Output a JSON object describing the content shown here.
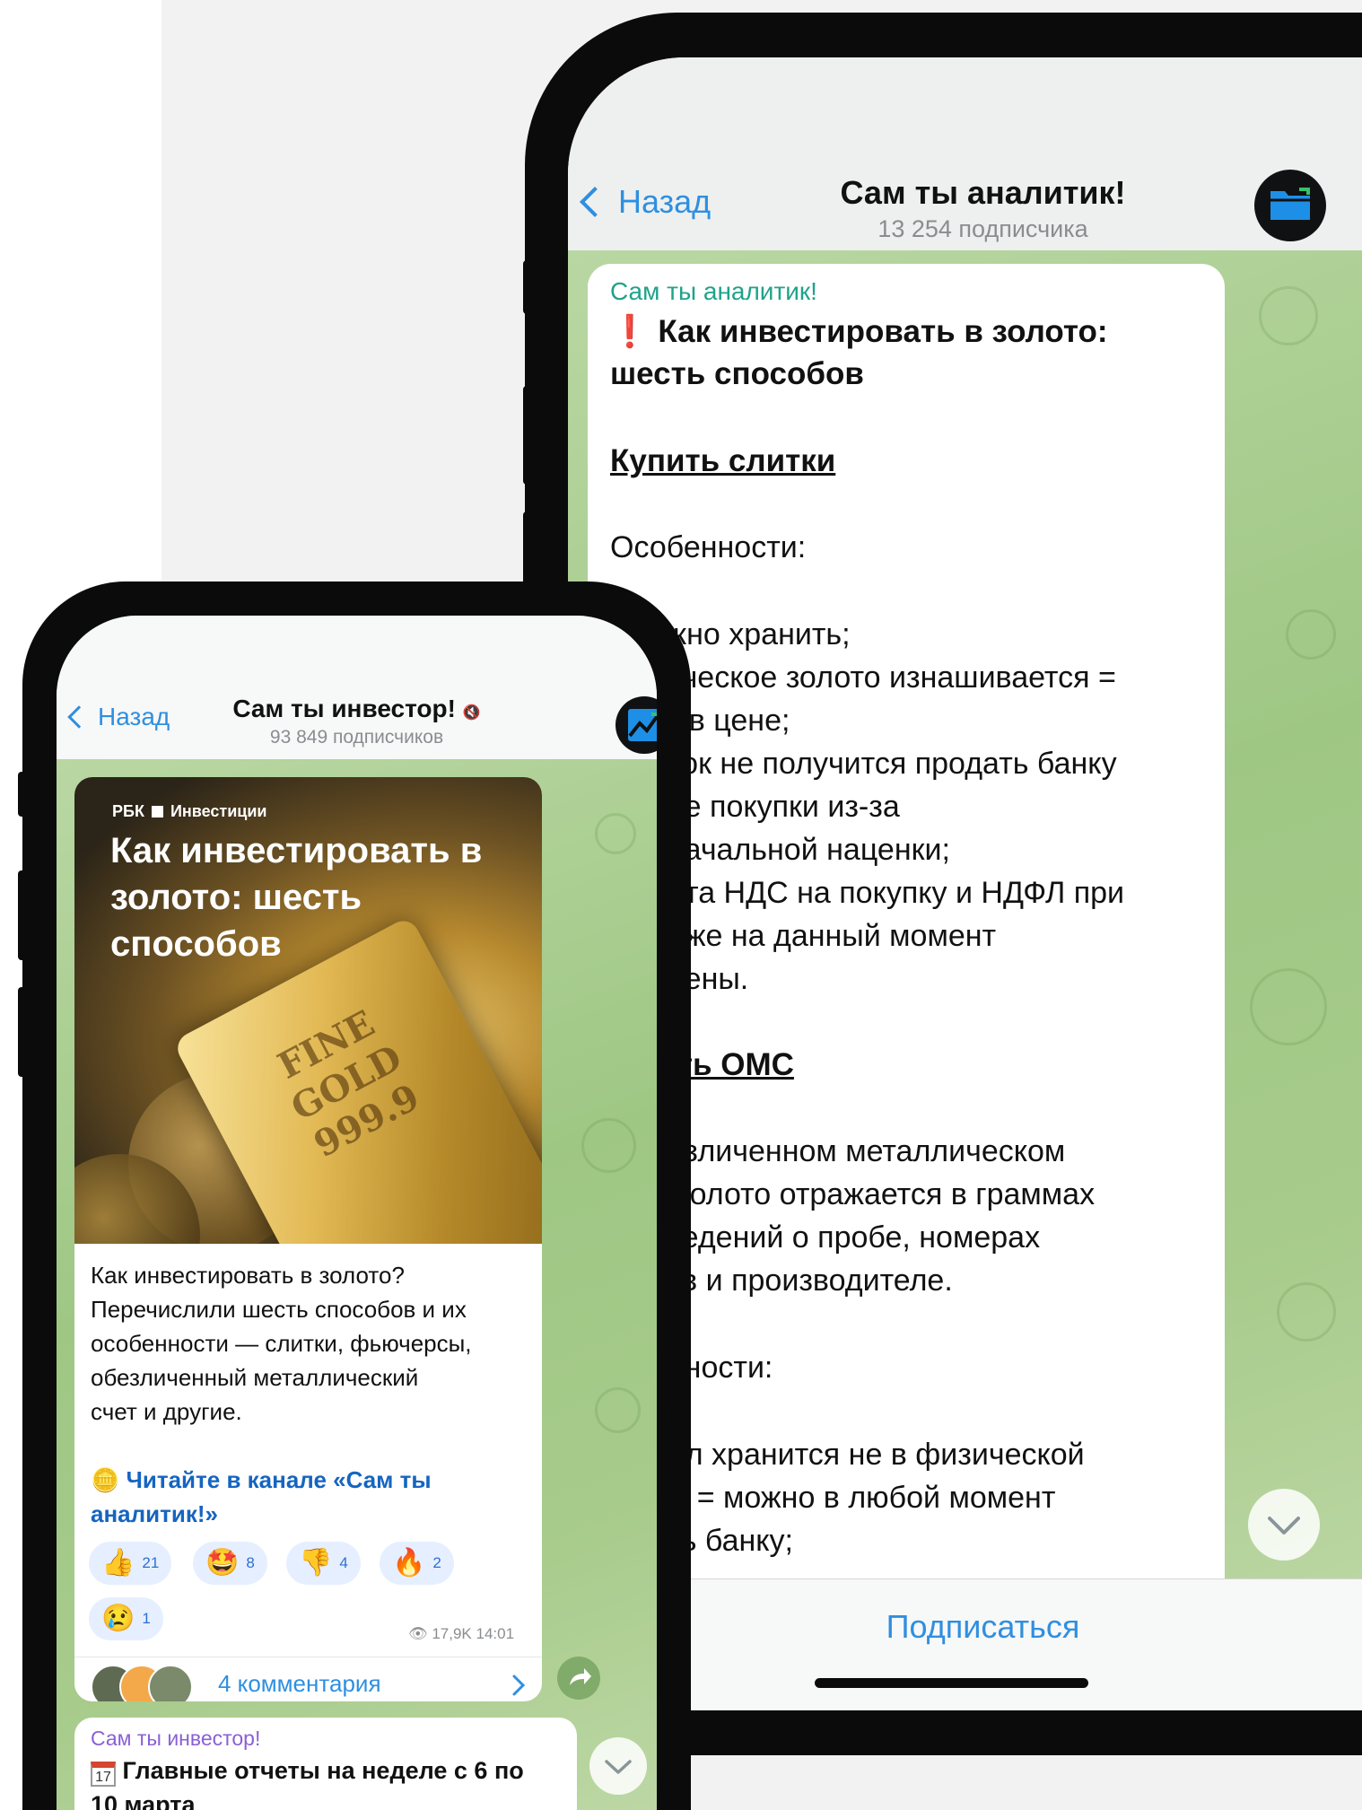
{
  "back_phone": {
    "back_label": "Назад",
    "channel_title": "Сам ты аналитик!",
    "subscribers": "13 254 подписчика",
    "avatar_icon": "folder-icon",
    "message": {
      "sender": "Сам ты аналитик!",
      "headline_emoji": "❗",
      "headline_line1": "Как инвестировать в золото:",
      "headline_line2": "шесть способов",
      "section1_title": "Купить слитки",
      "features_label": "Особенности:",
      "lines": [
        "ужно хранить;",
        "зическое золото изнашивается =",
        "ет в цене;",
        "иток не получится продать банку",
        "ене покупки из-за",
        "оначальной наценки;",
        "лата НДС на покупку и НДФЛ при",
        "даже на данный момент",
        "енены."
      ],
      "section2_title": "ыть ОМС",
      "lines2": [
        "безличенном металлическом",
        "е золото отражается в граммах",
        "сведений о пробе, номерах",
        "ков и производителе."
      ],
      "features_label2": "енности:",
      "lines3": [
        "алл хранится не в физической",
        "ме = можно в любой момент",
        "ать банку;"
      ]
    },
    "subscribe_label": "Подписаться",
    "scroll_icon": "chevron-down-icon"
  },
  "front_phone": {
    "back_label": "Назад",
    "channel_title": "Сам ты инвестор!",
    "mute_icon": "speaker-muted-icon",
    "subscribers": "93 849 подписчиков",
    "avatar_icon": "chart-up-icon",
    "post": {
      "image_brand": "РБК",
      "image_brand_suffix": "Инвестиции",
      "image_title_line1": "Как инвестировать в",
      "image_title_line2": "золото: шесть",
      "image_title_line3": "способов",
      "gold_bar_text": "FINE GOLD 999.9",
      "body_lines": [
        "Как инвестировать в золото?",
        "Перечислили шесть способов и их",
        "особенности — слитки, фьючерсы,",
        "обезличенный металлический",
        "счет и другие."
      ],
      "link_emoji": "🪙",
      "link_line1": "Читайте в канале «Сам ты",
      "link_line2": "аналитик!»",
      "reactions": [
        {
          "emoji": "👍",
          "count": "21"
        },
        {
          "emoji": "🤩",
          "count": "8"
        },
        {
          "emoji": "👎",
          "count": "4"
        },
        {
          "emoji": "🔥",
          "count": "2"
        },
        {
          "emoji": "😢",
          "count": "1"
        }
      ],
      "views": "17,9K",
      "time": "14:01",
      "comments": "4 комментария"
    },
    "next_message": {
      "sender": "Сам ты инвестор!",
      "calendar_day": "17",
      "line1": "Главные отчеты на неделе с 6 по",
      "line2": "10 марта"
    }
  },
  "colors": {
    "accent_blue": "#2f8fe0",
    "sender_green": "#1fa38a",
    "sender_purple": "#8b5fd6",
    "link_blue": "#1565c0",
    "chat_green": "#a5ca89"
  }
}
